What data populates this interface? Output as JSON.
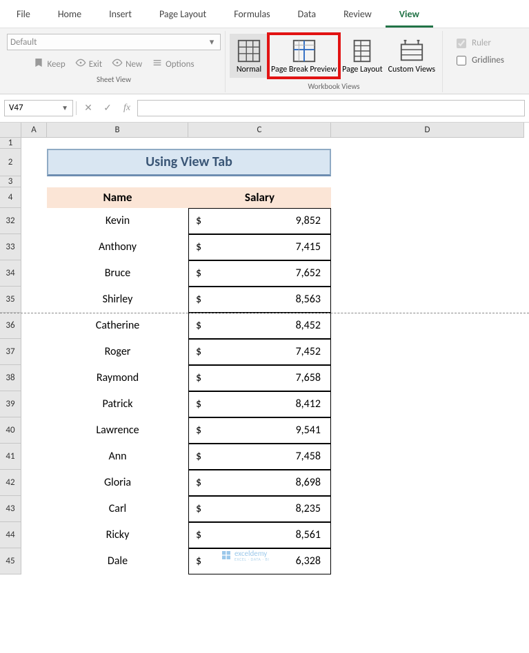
{
  "ribbon": {
    "tabs": [
      "File",
      "Home",
      "Insert",
      "Page Layout",
      "Formulas",
      "Data",
      "Review",
      "View"
    ],
    "active_tab": "View",
    "sheet_view": {
      "dropdown_value": "Default",
      "keep": "Keep",
      "exit": "Exit",
      "new": "New",
      "options": "Options",
      "group_label": "Sheet View"
    },
    "workbook_views": {
      "normal": "Normal",
      "page_break": "Page Break Preview",
      "page_layout": "Page Layout",
      "custom": "Custom Views",
      "group_label": "Workbook Views"
    },
    "show": {
      "ruler": "Ruler",
      "gridlines": "Gridlines"
    }
  },
  "formula_bar": {
    "name_box": "V47",
    "fx": "fx"
  },
  "columns": [
    "A",
    "B",
    "C",
    "D"
  ],
  "col_widths": {
    "A": 37,
    "B": 205,
    "C": 207,
    "D": 280
  },
  "rows": [
    "1",
    "2",
    "3",
    "4",
    "32",
    "33",
    "34",
    "35",
    "36",
    "37",
    "38",
    "39",
    "40",
    "41",
    "42",
    "43",
    "44",
    "45"
  ],
  "sheet": {
    "title": "Using View Tab",
    "headers": {
      "name": "Name",
      "salary": "Salary"
    },
    "data": [
      {
        "name": "Kevin",
        "salary": "9,852"
      },
      {
        "name": "Anthony",
        "salary": "7,415"
      },
      {
        "name": "Bruce",
        "salary": "7,652"
      },
      {
        "name": "Shirley",
        "salary": "8,563"
      },
      {
        "name": "Catherine",
        "salary": "8,452"
      },
      {
        "name": "Roger",
        "salary": "7,452"
      },
      {
        "name": "Raymond",
        "salary": "7,658"
      },
      {
        "name": "Patrick",
        "salary": "8,412"
      },
      {
        "name": "Lawrence",
        "salary": "9,541"
      },
      {
        "name": "Ann",
        "salary": "7,458"
      },
      {
        "name": "Gloria",
        "salary": "8,698"
      },
      {
        "name": "Carl",
        "salary": "8,235"
      },
      {
        "name": "Ricky",
        "salary": "8,561"
      },
      {
        "name": "Dale",
        "salary": "6,328"
      }
    ],
    "currency": "$"
  },
  "watermark": {
    "name": "exceldemy",
    "sub": "EXCEL · DATA · BI"
  }
}
